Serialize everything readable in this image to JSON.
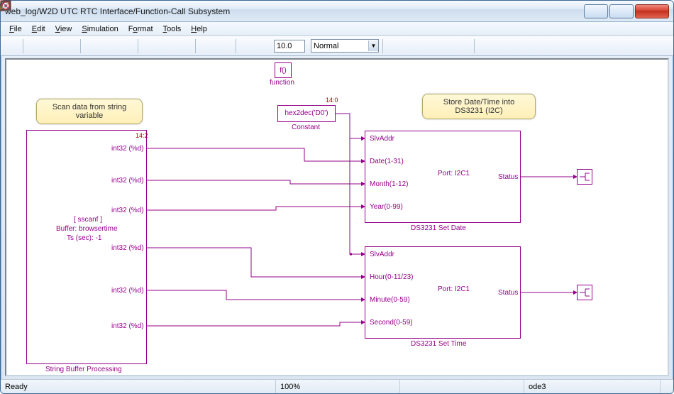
{
  "window": {
    "title": "web_log/W2D UTC RTC Interface/Function-Call Subsystem"
  },
  "menu": {
    "file": "File",
    "edit": "Edit",
    "view": "View",
    "simulation": "Simulation",
    "format": "Format",
    "tools": "Tools",
    "help": "Help"
  },
  "toolbar": {
    "stoptime": "10.0",
    "mode": "Normal"
  },
  "diagram": {
    "note_scan": "Scan data from string\nvariable",
    "note_store": "Store Date/Time into\nDS3231 (I2C)",
    "func_top": "f()",
    "func_bottom": "function",
    "const_text": "hex2dec('D0')",
    "const_caption": "Constant",
    "const_dim": "14:0",
    "scan": {
      "dim": "14:2",
      "p1": "int32 (%d)",
      "p2": "int32 (%d)",
      "p3": "int32 (%d)",
      "p4": "int32 (%d)",
      "p5": "int32 (%d)",
      "p6": "int32 (%d)",
      "l1": "[ sscanf ]",
      "l2": "Buffer: browsertime",
      "l3": "Ts (sec): -1",
      "caption": "String Buffer Processing"
    },
    "date": {
      "in1": "SlvAddr",
      "in2": "Date(1-31)",
      "in3": "Month(1-12)",
      "in4": "Year(0-99)",
      "port": "Port: I2C1",
      "out": "Status",
      "caption": "DS3231 Set Date"
    },
    "time": {
      "in1": "SlvAddr",
      "in2": "Hour(0-11/23)",
      "in3": "Minute(0-59)",
      "in4": "Second(0-59)",
      "port": "Port: I2C1",
      "out": "Status",
      "caption": "DS3231 Set Time"
    }
  },
  "status": {
    "ready": "Ready",
    "zoom": "100%",
    "solver": "ode3"
  }
}
